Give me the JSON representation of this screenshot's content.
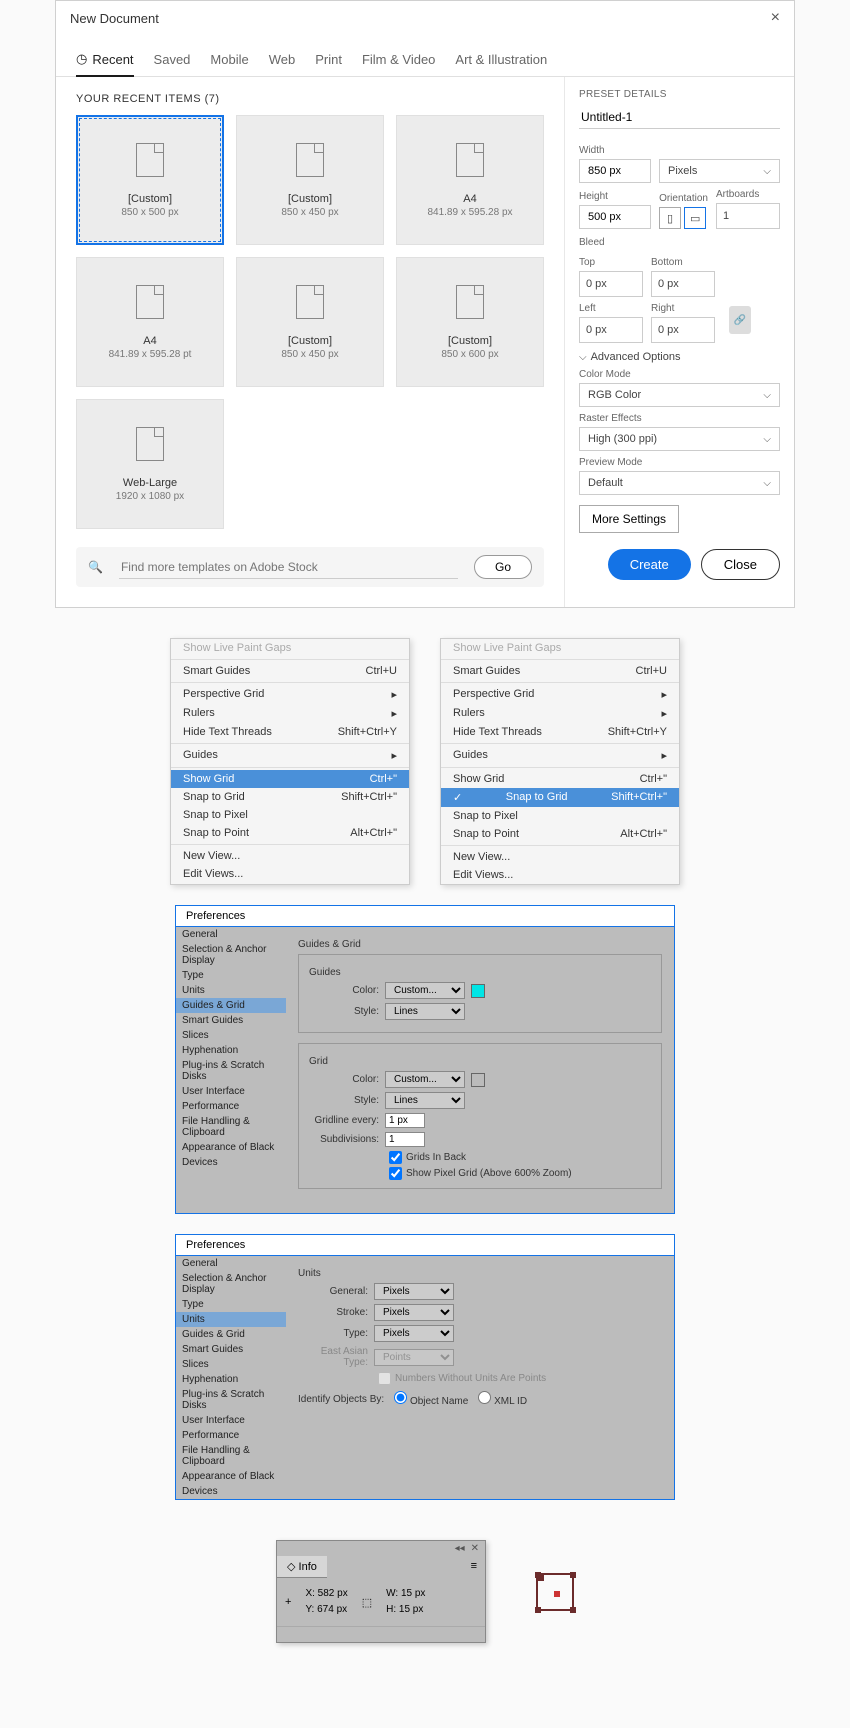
{
  "dialog": {
    "title": "New Document",
    "tabs": [
      "Recent",
      "Saved",
      "Mobile",
      "Web",
      "Print",
      "Film & Video",
      "Art & Illustration"
    ],
    "recent_label": "YOUR RECENT ITEMS  (7)",
    "presets": [
      {
        "name": "[Custom]",
        "dims": "850 x 500 px",
        "selected": true
      },
      {
        "name": "[Custom]",
        "dims": "850 x 450 px"
      },
      {
        "name": "A4",
        "dims": "841.89 x 595.28 px"
      },
      {
        "name": "A4",
        "dims": "841.89 x 595.28 pt"
      },
      {
        "name": "[Custom]",
        "dims": "850 x 450 px"
      },
      {
        "name": "[Custom]",
        "dims": "850 x 600 px"
      },
      {
        "name": "Web-Large",
        "dims": "1920 x 1080 px"
      }
    ],
    "search_placeholder": "Find more templates on Adobe Stock",
    "go": "Go",
    "details": {
      "header": "PRESET DETAILS",
      "name": "Untitled-1",
      "width_label": "Width",
      "width": "850 px",
      "units": "Pixels",
      "height_label": "Height",
      "height": "500 px",
      "orientation_label": "Orientation",
      "artboards_label": "Artboards",
      "artboards": "1",
      "bleed": "Bleed",
      "top": "Top",
      "bottom": "Bottom",
      "left": "Left",
      "right": "Right",
      "bleed_val": "0 px",
      "advanced": "Advanced Options",
      "color_mode_label": "Color Mode",
      "color_mode": "RGB Color",
      "raster_label": "Raster Effects",
      "raster": "High (300 ppi)",
      "preview_label": "Preview Mode",
      "preview": "Default",
      "more": "More Settings"
    },
    "create": "Create",
    "close": "Close"
  },
  "menu1": {
    "ghost": "Show Live Paint Gaps",
    "items": [
      {
        "label": "Smart Guides",
        "shortcut": "Ctrl+U"
      },
      {
        "label": "Perspective Grid",
        "sub": true
      },
      {
        "label": "Rulers",
        "sub": true
      },
      {
        "label": "Hide Text Threads",
        "shortcut": "Shift+Ctrl+Y"
      },
      {
        "label": "Guides",
        "sub": true
      },
      {
        "label": "Show Grid",
        "shortcut": "Ctrl+\"",
        "sel": true
      },
      {
        "label": "Snap to Grid",
        "shortcut": "Shift+Ctrl+\""
      },
      {
        "label": "Snap to Pixel"
      },
      {
        "label": "Snap to Point",
        "shortcut": "Alt+Ctrl+\""
      },
      {
        "label": "New View..."
      },
      {
        "label": "Edit Views..."
      }
    ]
  },
  "menu2": {
    "ghost": "Show Live Paint Gaps",
    "items": [
      {
        "label": "Smart Guides",
        "shortcut": "Ctrl+U"
      },
      {
        "label": "Perspective Grid",
        "sub": true
      },
      {
        "label": "Rulers",
        "sub": true
      },
      {
        "label": "Hide Text Threads",
        "shortcut": "Shift+Ctrl+Y"
      },
      {
        "label": "Guides",
        "sub": true
      },
      {
        "label": "Show Grid",
        "shortcut": "Ctrl+\""
      },
      {
        "label": "Snap to Grid",
        "shortcut": "Shift+Ctrl+\"",
        "sel": true,
        "check": true
      },
      {
        "label": "Snap to Pixel"
      },
      {
        "label": "Snap to Point",
        "shortcut": "Alt+Ctrl+\""
      },
      {
        "label": "New View..."
      },
      {
        "label": "Edit Views..."
      }
    ]
  },
  "prefs_side": [
    "General",
    "Selection & Anchor Display",
    "Type",
    "Units",
    "Guides & Grid",
    "Smart Guides",
    "Slices",
    "Hyphenation",
    "Plug-ins & Scratch Disks",
    "User Interface",
    "Performance",
    "File Handling & Clipboard",
    "Appearance of Black",
    "Devices"
  ],
  "prefs1": {
    "title": "Preferences",
    "active_side": "Guides & Grid",
    "main_title": "Guides & Grid",
    "guides": {
      "title": "Guides",
      "color_label": "Color:",
      "color": "Custom...",
      "style_label": "Style:",
      "style": "Lines"
    },
    "grid": {
      "title": "Grid",
      "color_label": "Color:",
      "color": "Custom...",
      "style_label": "Style:",
      "style": "Lines",
      "every_label": "Gridline every:",
      "every": "1 px",
      "sub_label": "Subdivisions:",
      "sub": "1",
      "cb1": "Grids In Back",
      "cb2": "Show Pixel Grid (Above 600% Zoom)"
    }
  },
  "prefs2": {
    "title": "Preferences",
    "active_side": "Units",
    "main_title": "Units",
    "general_label": "General:",
    "general": "Pixels",
    "stroke_label": "Stroke:",
    "stroke": "Pixels",
    "type_label": "Type:",
    "type": "Pixels",
    "east_label": "East Asian Type:",
    "east": "Points",
    "nounits": "Numbers Without Units Are Points",
    "identify": "Identify Objects By:",
    "opt1": "Object Name",
    "opt2": "XML ID"
  },
  "info": {
    "tab": "Info",
    "x_label": "X:",
    "x": "582 px",
    "y_label": "Y:",
    "y": "674 px",
    "w_label": "W:",
    "w": "15 px",
    "h_label": "H:",
    "h": "15 px"
  }
}
